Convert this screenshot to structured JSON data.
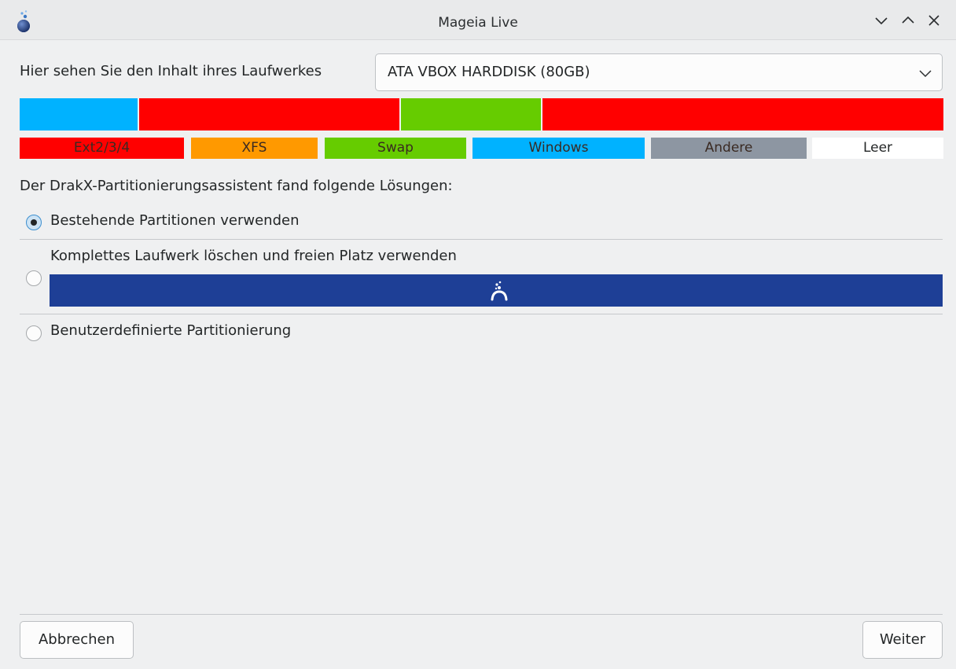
{
  "window": {
    "title": "Mageia Live"
  },
  "drive": {
    "label": "Hier sehen Sie den Inhalt ihres Laufwerkes",
    "selected": "ATA VBOX HARDDISK (80GB)"
  },
  "partitions": [
    {
      "type": "Windows",
      "fraction": 0.129,
      "color": "#00b2ff"
    },
    {
      "type": "Ext2/3/4",
      "fraction": 0.283,
      "color": "#ff0000"
    },
    {
      "type": "Swap",
      "fraction": 0.153,
      "color": "#66cc00"
    },
    {
      "type": "Ext2/3/4",
      "fraction": 0.435,
      "color": "#ff0000"
    }
  ],
  "legend": [
    {
      "label": "Ext2/3/4",
      "bg": "#ff0000"
    },
    {
      "label": "XFS",
      "bg": "#ff9900"
    },
    {
      "label": "Swap",
      "bg": "#66cc00"
    },
    {
      "label": "Windows",
      "bg": "#00b2ff"
    },
    {
      "label": "Andere",
      "bg": "#8d96a2"
    },
    {
      "label": "Leer",
      "bg": "#ffffff"
    }
  ],
  "solutions": {
    "label": "Der DrakX-Partitionierungsassistent fand folgende Lösungen:",
    "options": [
      {
        "label": "Bestehende Partitionen verwenden",
        "checked": true
      },
      {
        "label": "Komplettes Laufwerk löschen und freien Platz verwenden",
        "checked": false
      },
      {
        "label": "Benutzerdefinierte Partitionierung",
        "checked": false
      }
    ],
    "erase_bar_color": "#1e3f96"
  },
  "buttons": {
    "cancel": "Abbrechen",
    "next": "Weiter"
  },
  "icons": {
    "app": "mageia-icon",
    "minimize": "chevron-down-icon",
    "maximize": "chevron-up-icon",
    "close": "close-icon"
  }
}
